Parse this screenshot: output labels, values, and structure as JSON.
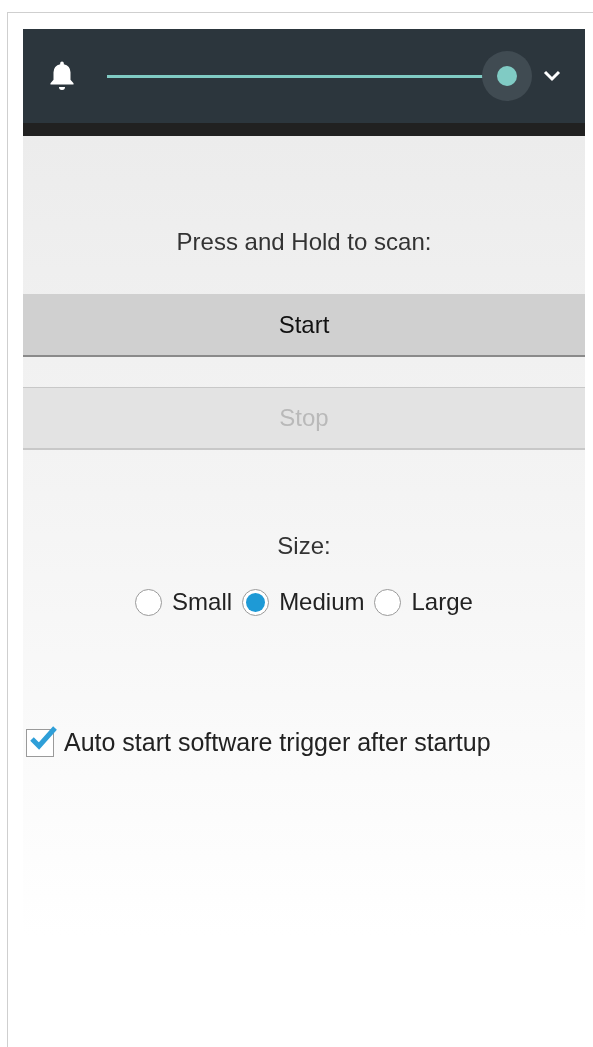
{
  "volume": {
    "level": 1.0
  },
  "instruction": "Press and Hold to scan:",
  "buttons": [
    {
      "label": "Start",
      "disabled": false
    },
    {
      "label": "Stop",
      "disabled": true
    }
  ],
  "size": {
    "label": "Size:",
    "options": [
      {
        "label": "Small",
        "selected": false
      },
      {
        "label": "Medium",
        "selected": true
      },
      {
        "label": "Large",
        "selected": false
      }
    ]
  },
  "auto_start": {
    "label": "Auto start software trigger after startup",
    "checked": true
  }
}
